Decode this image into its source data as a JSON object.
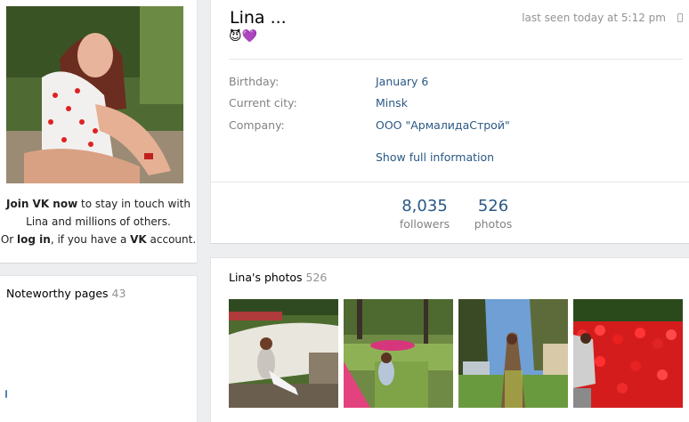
{
  "sidebar": {
    "join": {
      "join_link": "Join VK now",
      "join_rest": " to stay in touch with",
      "line2": "Lina and millions of others.",
      "or_text": "Or ",
      "login_link": "log in",
      "if_text": ", if you have a ",
      "vk_text": "VK",
      "account_text": " account."
    },
    "noteworthy": {
      "label": "Noteworthy pages",
      "count": "43"
    }
  },
  "profile": {
    "name": "Lina ...",
    "emoji": "😈💜",
    "last_seen": "last seen today at 5:12 pm",
    "info": [
      {
        "label": "Birthday:",
        "value": "January 6"
      },
      {
        "label": "Current city:",
        "value": "Minsk"
      },
      {
        "label": "Company:",
        "value": "ООО \"АрмалидаСтрой\""
      }
    ],
    "show_full": "Show full information",
    "counters": [
      {
        "num": "8,035",
        "label": "followers"
      },
      {
        "num": "526",
        "label": "photos"
      }
    ]
  },
  "photos": {
    "title": "Lina's photos",
    "count": "526"
  },
  "icons": [
    "phone-icon"
  ],
  "colors": {
    "link": "#2a5885",
    "muted": "#828282",
    "bg": "#edeef0"
  }
}
